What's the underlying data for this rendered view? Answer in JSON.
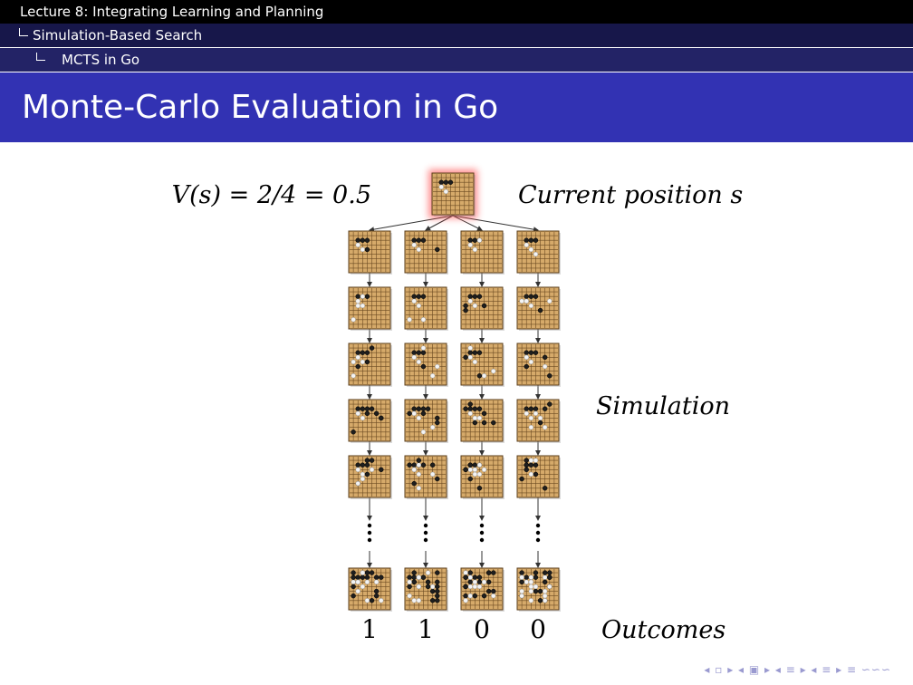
{
  "header": {
    "section": "Lecture 8: Integrating Learning and Planning",
    "subsection": "Simulation-Based Search",
    "subsubsection": "MCTS in Go"
  },
  "slide": {
    "title": "Monte-Carlo Evaluation in Go"
  },
  "diagram": {
    "value_label": "V(s) = 2/4 = 0.5",
    "current_label": "Current position s",
    "simulation_label": "Simulation",
    "outcomes_label": "Outcomes",
    "outcomes": [
      "1",
      "1",
      "0",
      "0"
    ],
    "root_highlight_color": "#ff3333",
    "board_color": "#d6aa6a"
  },
  "footer": {
    "nav_symbols": "◂ ▫ ▸ ◂ ▣ ▸ ◂ ≡ ▸ ◂ ≡ ▸ ≡ ∽∽∽"
  }
}
